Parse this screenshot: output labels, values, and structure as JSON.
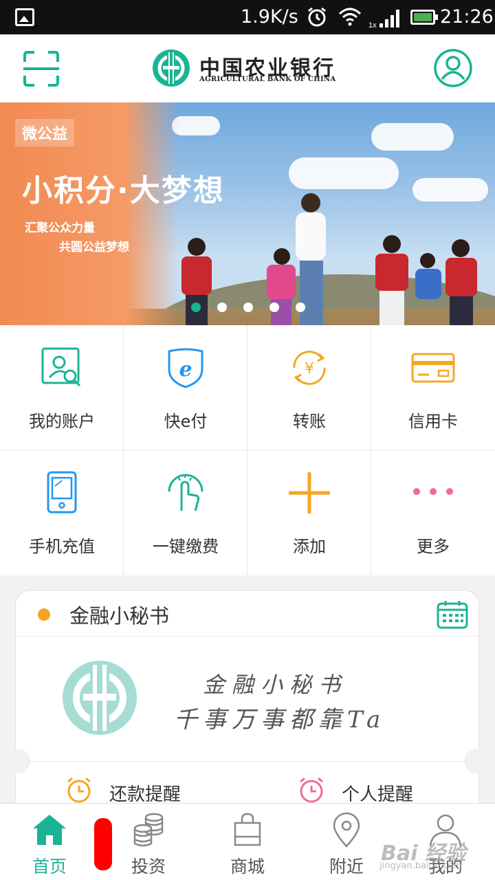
{
  "status_bar": {
    "speed": "1.9K/s",
    "signal_label": "1x",
    "time": "21:26",
    "icons": [
      "image-icon",
      "alarm-icon",
      "wifi-icon",
      "signal-icon",
      "battery-icon"
    ]
  },
  "header": {
    "logo_cn": "中国农业银行",
    "logo_en": "AGRICULTURAL BANK OF CHINA",
    "scan_icon": "scan-icon",
    "profile_icon": "user-circle-icon",
    "brand_color": "#1ab394"
  },
  "banner": {
    "tag": "微公益",
    "title": "小积分·大梦想",
    "subtitle_1": "汇聚公众力量",
    "subtitle_2": "共圆公益梦想",
    "slide_count": 5,
    "active_slide": 1
  },
  "grid": {
    "items": [
      {
        "label": "我的账户",
        "icon": "account-search-icon"
      },
      {
        "label": "快e付",
        "icon": "e-pay-shield-icon"
      },
      {
        "label": "转账",
        "icon": "transfer-yuan-icon"
      },
      {
        "label": "信用卡",
        "icon": "credit-card-icon"
      },
      {
        "label": "手机充值",
        "icon": "phone-recharge-icon"
      },
      {
        "label": "一键缴费",
        "icon": "one-tap-payment-icon"
      },
      {
        "label": "添加",
        "icon": "plus-icon"
      },
      {
        "label": "更多",
        "icon": "more-dots-icon"
      }
    ]
  },
  "secretary": {
    "title": "金融小秘书",
    "calendar_icon": "calendar-icon",
    "handwriting_1": "金融小秘书",
    "handwriting_2": "千事万事都靠Ta",
    "reminders": [
      {
        "label": "还款提醒",
        "icon": "alarm-clock-icon",
        "color": "#f5a623"
      },
      {
        "label": "个人提醒",
        "icon": "alarm-clock-icon",
        "color": "#f06e8c"
      }
    ]
  },
  "bottom_nav": {
    "items": [
      {
        "label": "首页",
        "icon": "home-icon",
        "active": true
      },
      {
        "label": "投资",
        "icon": "coins-icon",
        "active": false
      },
      {
        "label": "商城",
        "icon": "shopping-bag-icon",
        "active": false
      },
      {
        "label": "附近",
        "icon": "location-pin-icon",
        "active": false
      },
      {
        "label": "我的",
        "icon": "user-icon",
        "active": false
      }
    ]
  },
  "watermark": {
    "text": "Bai 经验",
    "url_text": "jingyan.baidu.com"
  }
}
